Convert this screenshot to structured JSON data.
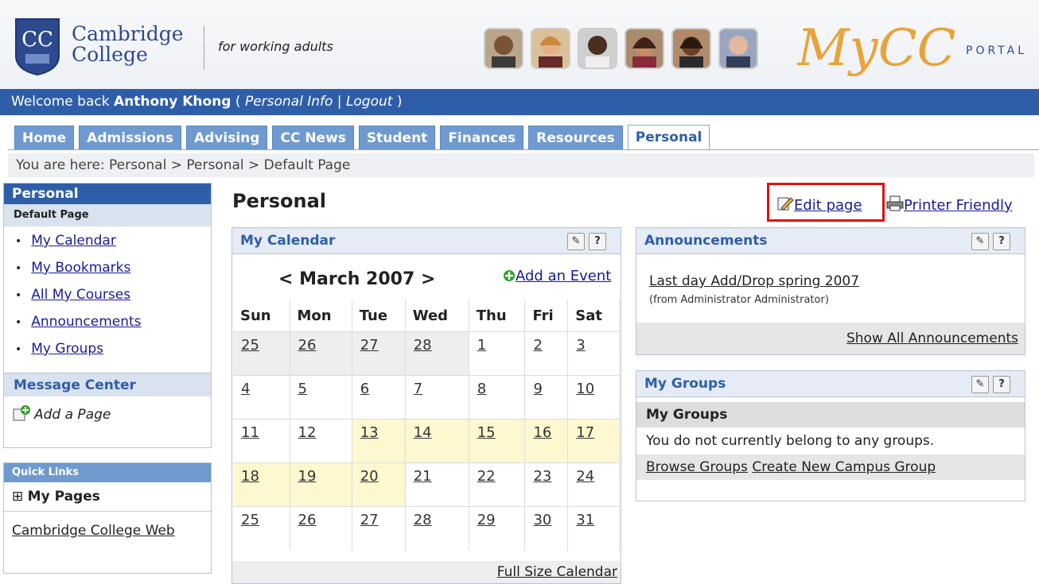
{
  "header": {
    "college_name_line1": "Cambridge",
    "college_name_line2": "College",
    "crest_letters": "CC",
    "tagline": "for working adults",
    "portal_logo_main": "MyCC",
    "portal_logo_sub": "PORTAL"
  },
  "welcome": {
    "prefix": "Welcome back",
    "user_name": "Anthony Khong",
    "open_paren": "(",
    "personal_info_link": "Personal Info",
    "separator": "|",
    "logout_link": "Logout",
    "close_paren": ")"
  },
  "tabs": [
    {
      "label": "Home",
      "active": false
    },
    {
      "label": "Admissions",
      "active": false
    },
    {
      "label": "Advising",
      "active": false
    },
    {
      "label": "CC News",
      "active": false
    },
    {
      "label": "Student",
      "active": false
    },
    {
      "label": "Finances",
      "active": false
    },
    {
      "label": "Resources",
      "active": false
    },
    {
      "label": "Personal",
      "active": true
    }
  ],
  "breadcrumb": "You are here:  Personal > Personal > Default Page",
  "sidebar": {
    "title": "Personal",
    "subtitle": "Default Page",
    "items": [
      {
        "label": "My Calendar"
      },
      {
        "label": "My Bookmarks"
      },
      {
        "label": "All My Courses"
      },
      {
        "label": "Announcements"
      },
      {
        "label": "My Groups"
      }
    ],
    "message_center": "Message Center",
    "add_page": "Add a Page"
  },
  "quick_links": {
    "title": "Quick Links",
    "my_pages_expander": "⊞",
    "my_pages": "My Pages",
    "cambridge_web": "Cambridge College Web"
  },
  "main": {
    "page_title": "Personal",
    "edit_page": "Edit page",
    "printer_friendly": "Printer Friendly"
  },
  "calendar": {
    "title": "My Calendar",
    "nav_prev": "<",
    "month_label": "March 2007",
    "nav_next": ">",
    "add_event": "Add an Event",
    "weekdays": [
      "Sun",
      "Mon",
      "Tue",
      "Wed",
      "Thu",
      "Fri",
      "Sat"
    ],
    "weeks": [
      [
        {
          "d": "25",
          "other": true
        },
        {
          "d": "26",
          "other": true
        },
        {
          "d": "27",
          "other": true
        },
        {
          "d": "28",
          "other": true
        },
        {
          "d": "1"
        },
        {
          "d": "2"
        },
        {
          "d": "3"
        }
      ],
      [
        {
          "d": "4"
        },
        {
          "d": "5"
        },
        {
          "d": "6"
        },
        {
          "d": "7"
        },
        {
          "d": "8"
        },
        {
          "d": "9"
        },
        {
          "d": "10"
        }
      ],
      [
        {
          "d": "11"
        },
        {
          "d": "12"
        },
        {
          "d": "13",
          "hl": true
        },
        {
          "d": "14",
          "hl": true
        },
        {
          "d": "15",
          "hl": true
        },
        {
          "d": "16",
          "hl": true
        },
        {
          "d": "17",
          "hl": true
        }
      ],
      [
        {
          "d": "18",
          "hl": true
        },
        {
          "d": "19",
          "hl": true
        },
        {
          "d": "20",
          "hl": true
        },
        {
          "d": "21"
        },
        {
          "d": "22"
        },
        {
          "d": "23"
        },
        {
          "d": "24"
        }
      ],
      [
        {
          "d": "25"
        },
        {
          "d": "26"
        },
        {
          "d": "27"
        },
        {
          "d": "28"
        },
        {
          "d": "29"
        },
        {
          "d": "30"
        },
        {
          "d": "31"
        }
      ]
    ],
    "full_size": "Full Size Calendar",
    "highlight_color": "#fdf8cf"
  },
  "announcements": {
    "title": "Announcements",
    "item_title": "Last day Add/Drop spring 2007",
    "item_from": "(from Administrator Administrator)",
    "show_all": "Show All Announcements"
  },
  "groups": {
    "title": "My Groups",
    "subheader": "My Groups",
    "message": "You do not currently belong to any groups.",
    "browse": "Browse Groups",
    "create": "Create New Campus Group"
  },
  "portlet_icons": {
    "settings": "✎",
    "help": "?"
  },
  "colors": {
    "brand_blue": "#2f5ea8",
    "tab_blue": "#6f9ad0",
    "highlight_red": "#e01010",
    "logo_orange": "#e8a33a"
  }
}
